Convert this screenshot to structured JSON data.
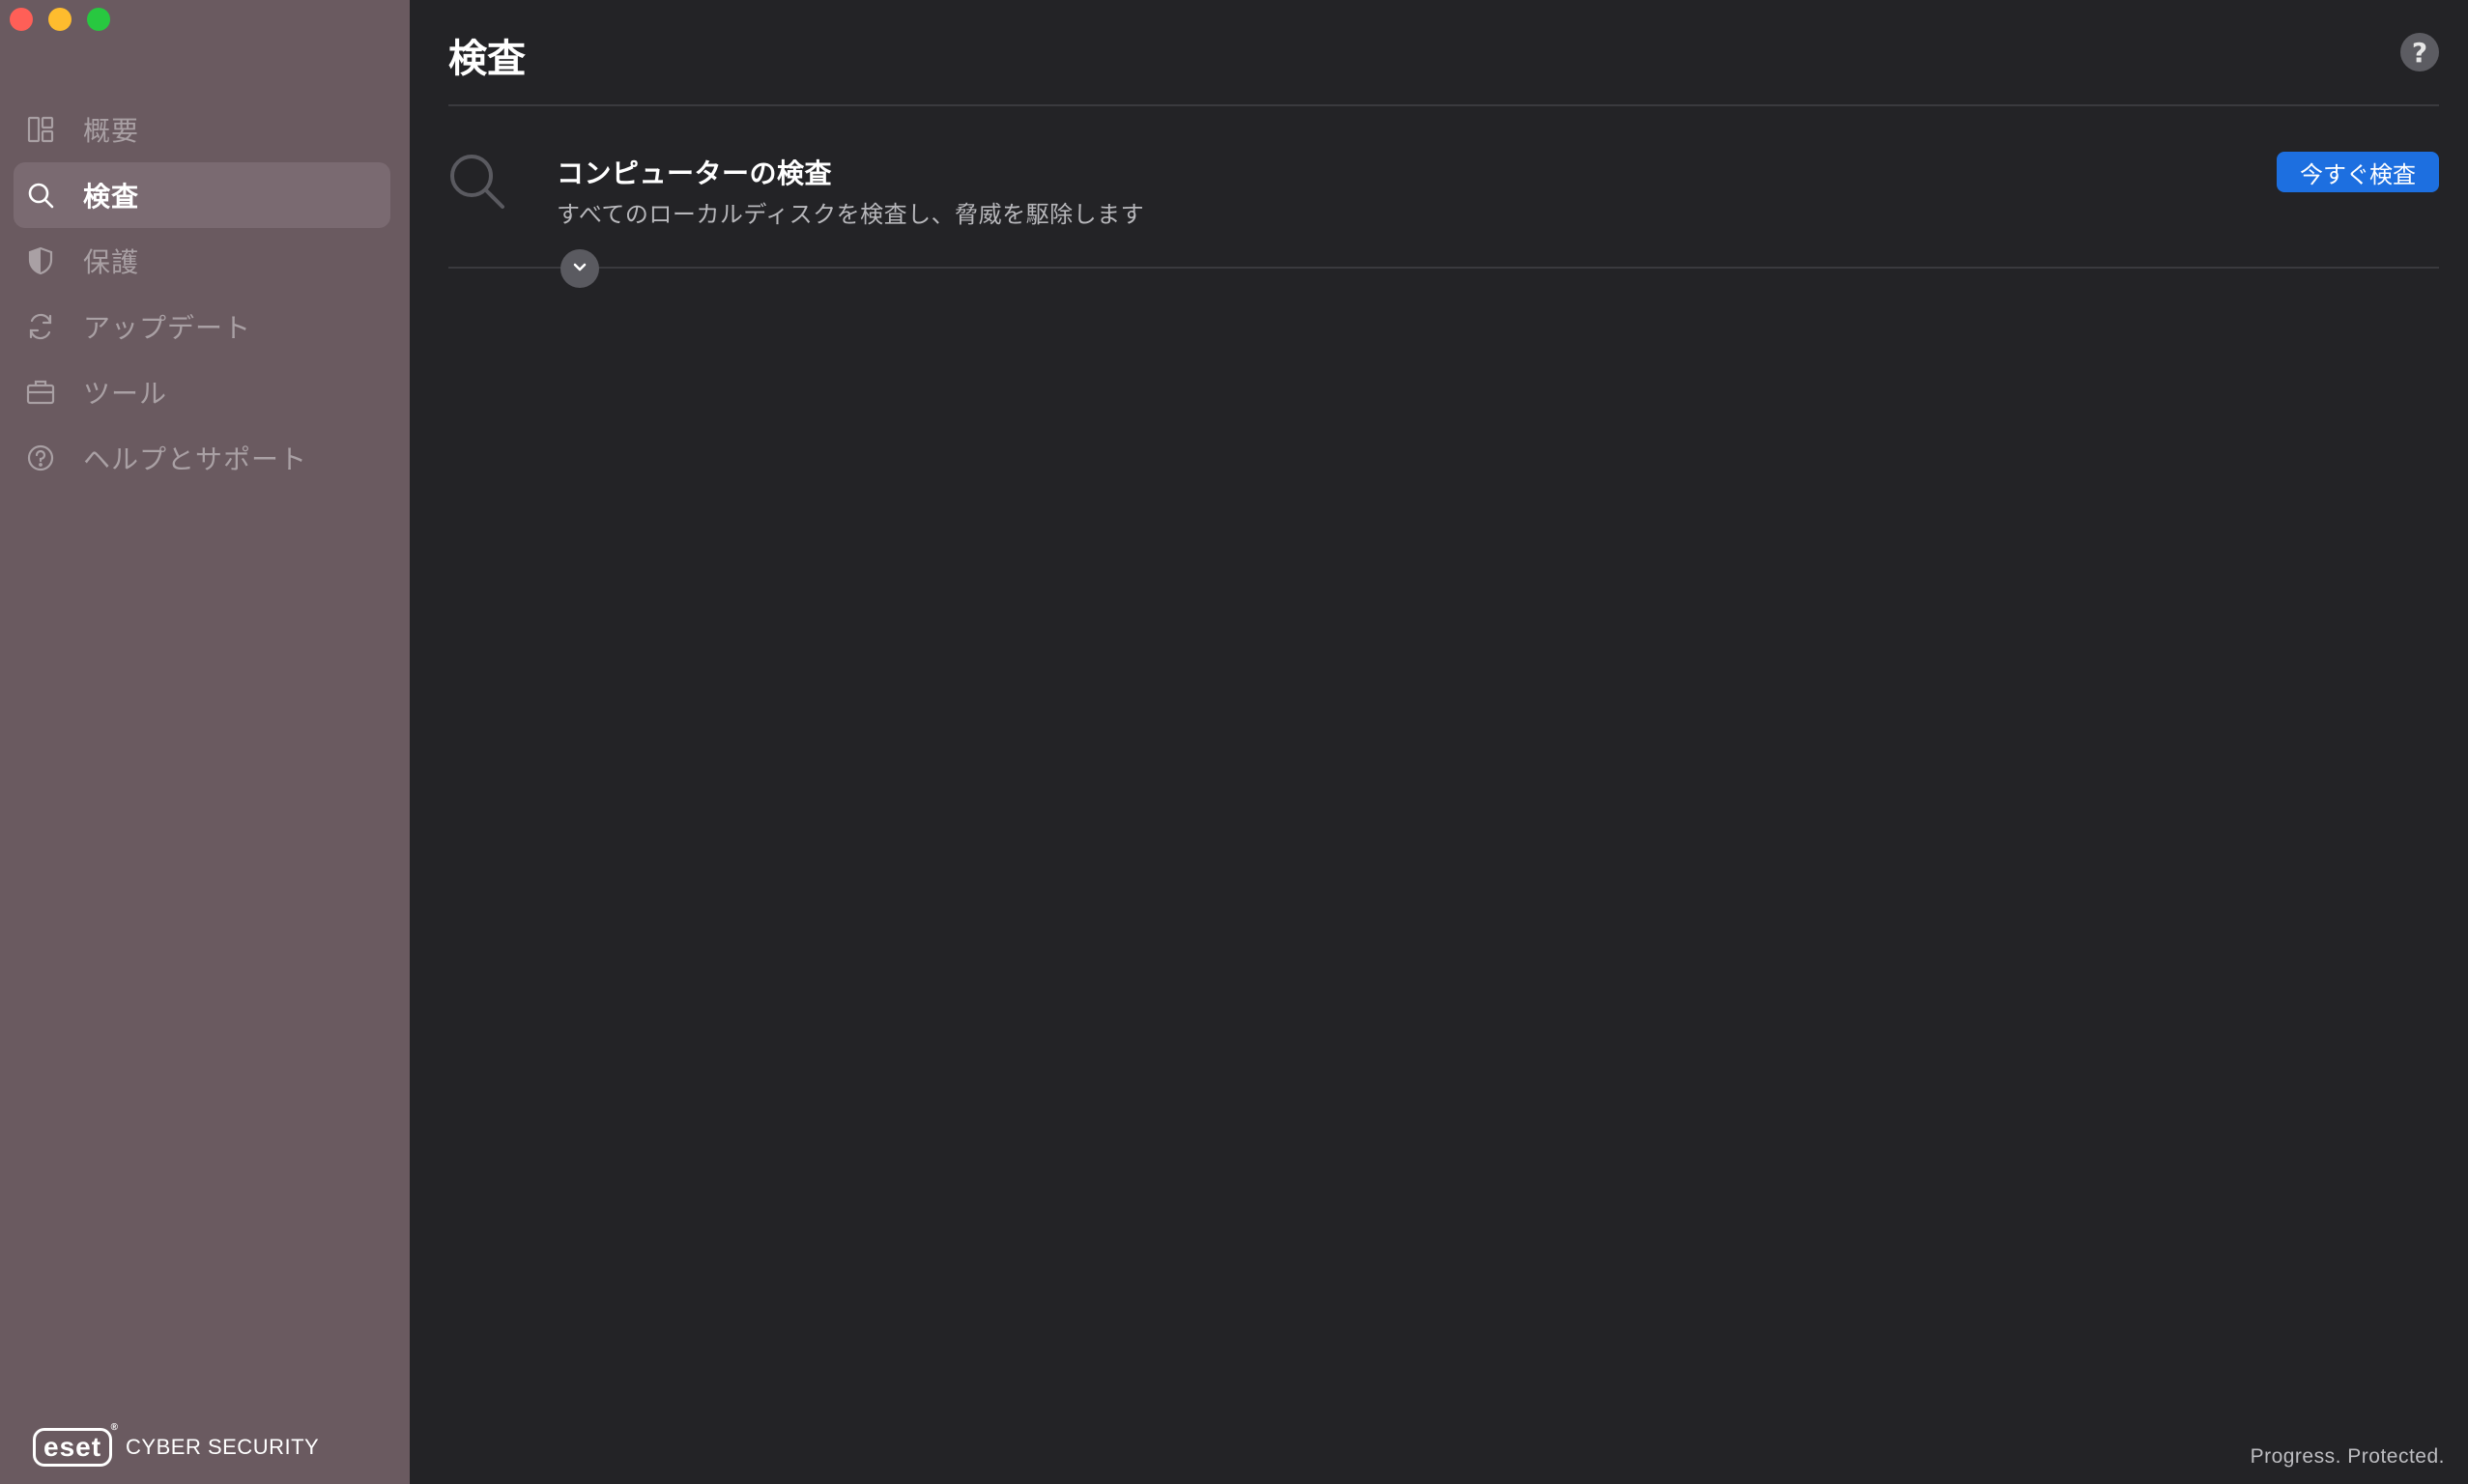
{
  "window": {
    "controls": {
      "close_color": "#ff5f57",
      "minimize_color": "#febc2e",
      "zoom_color": "#28c840"
    }
  },
  "sidebar": {
    "background": "#6a5a60",
    "items": [
      {
        "label": "概要",
        "icon": "dashboard-icon",
        "active": false
      },
      {
        "label": "検査",
        "icon": "search-icon",
        "active": true
      },
      {
        "label": "保護",
        "icon": "shield-icon",
        "active": false
      },
      {
        "label": "アップデート",
        "icon": "refresh-icon",
        "active": false
      },
      {
        "label": "ツール",
        "icon": "briefcase-icon",
        "active": false
      },
      {
        "label": "ヘルプとサポート",
        "icon": "help-circle-icon",
        "active": false
      }
    ],
    "brand": {
      "logo_text": "eset",
      "registered_mark": "®",
      "product_name": "CYBER SECURITY"
    }
  },
  "header": {
    "title": "検査",
    "help_label": "?"
  },
  "scan_card": {
    "icon": "magnifier-icon",
    "title": "コンピューターの検査",
    "description": "すべてのローカルディスクを検査し、脅威を駆除します",
    "action_label": "今すぐ検査",
    "action_color": "#1d6fe0"
  },
  "footer": {
    "tagline": "Progress. Protected."
  }
}
